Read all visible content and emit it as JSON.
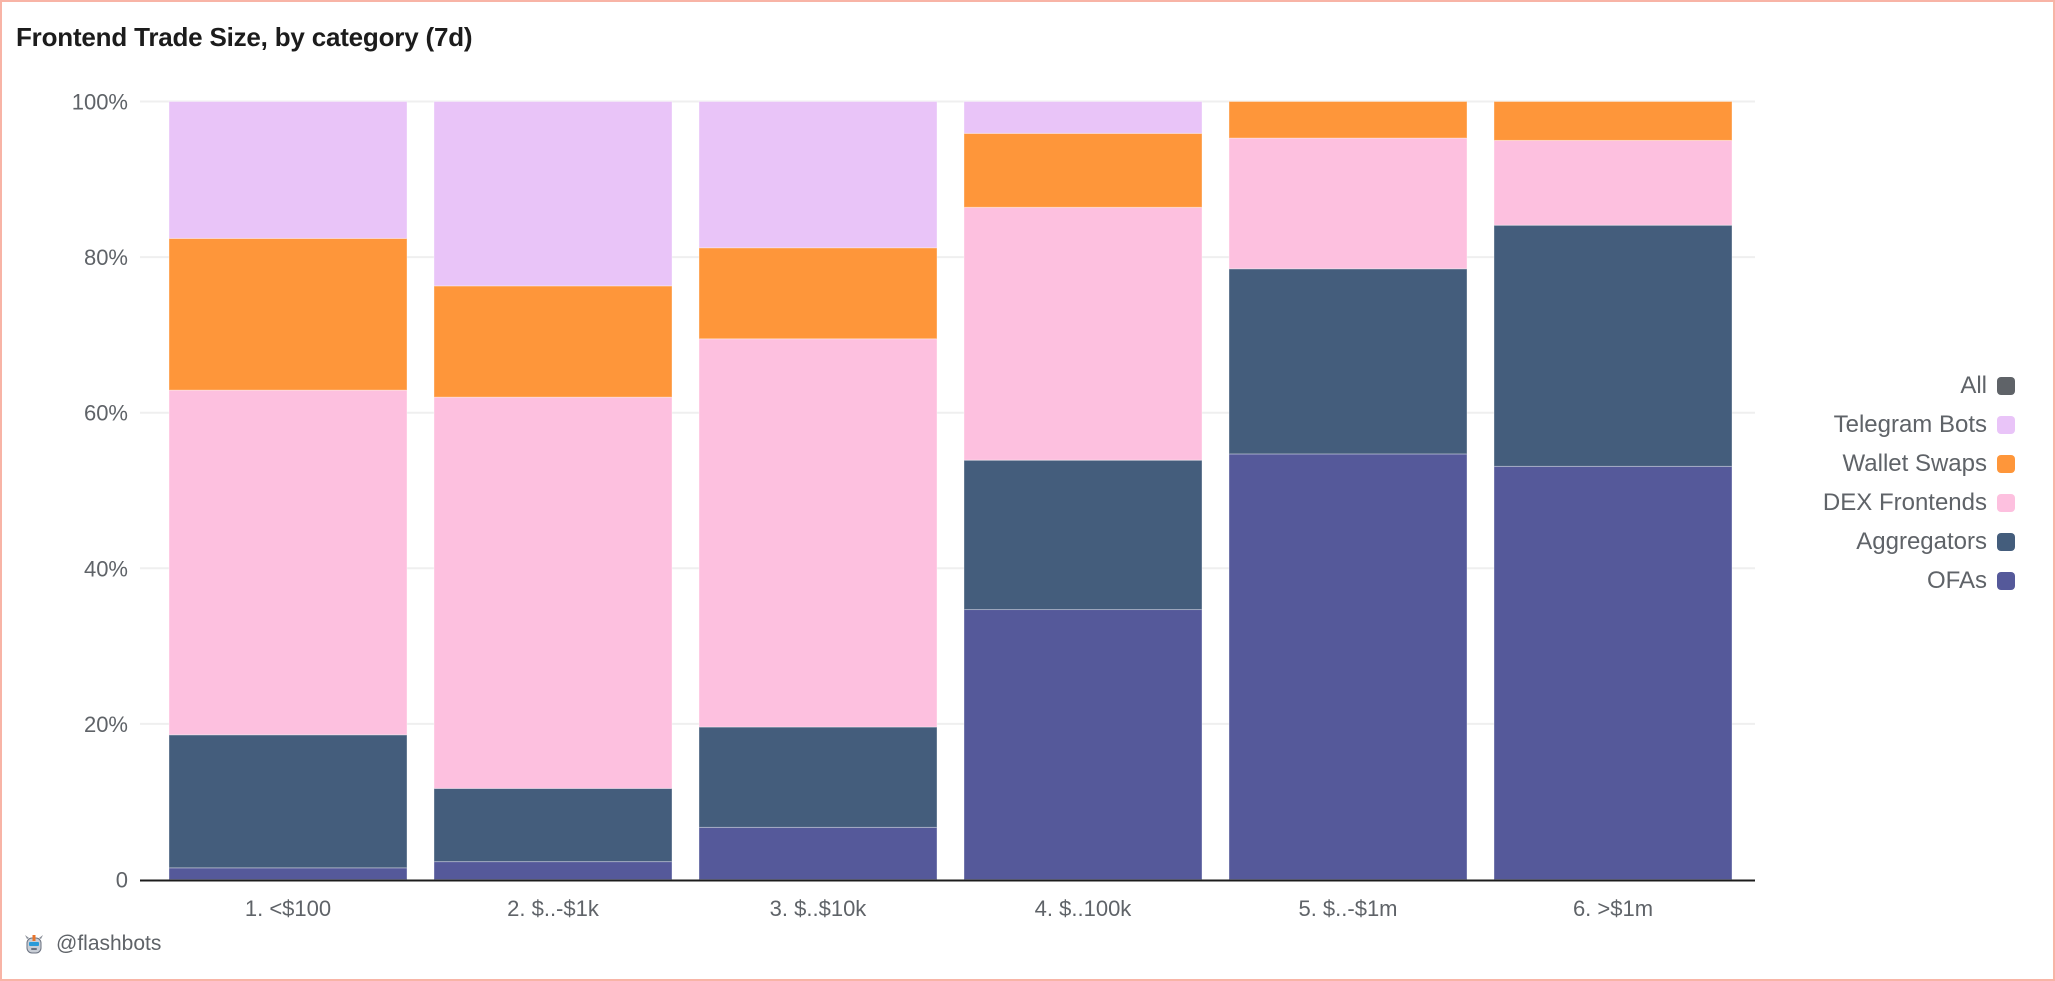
{
  "chart_data": {
    "type": "bar",
    "stacked": true,
    "normalized": true,
    "title": "Frontend Trade Size, by category (7d)",
    "xlabel": "",
    "ylabel": "",
    "ylim": [
      0,
      100
    ],
    "yticks": [
      0,
      20,
      40,
      60,
      80,
      100
    ],
    "ytick_labels": [
      "0",
      "20%",
      "40%",
      "60%",
      "80%",
      "100%"
    ],
    "grid": true,
    "legend_position": "right",
    "categories": [
      "1. <$100",
      "2. $..-$1k",
      "3. $..$10k",
      "4. $..100k",
      "5. $..-$1m",
      "6. >$1m"
    ],
    "series": [
      {
        "name": "OFAs",
        "color": "#55599a",
        "values": [
          1.5,
          2.3,
          6.7,
          34.7,
          54.7,
          53.1
        ]
      },
      {
        "name": "Aggregators",
        "color": "#445d7c",
        "values": [
          17.1,
          9.4,
          12.9,
          19.2,
          23.8,
          31.0
        ]
      },
      {
        "name": "DEX Frontends",
        "color": "#fdc0df",
        "values": [
          44.3,
          50.3,
          49.9,
          32.5,
          16.8,
          10.9
        ]
      },
      {
        "name": "Wallet Swaps",
        "color": "#fe963a",
        "values": [
          19.5,
          14.3,
          11.7,
          9.5,
          4.7,
          5.0
        ]
      },
      {
        "name": "Telegram Bots",
        "color": "#e9c4f8",
        "values": [
          17.6,
          23.7,
          18.8,
          4.1,
          0.0,
          0.0
        ]
      }
    ]
  },
  "legend": {
    "items": [
      {
        "label": "All",
        "color": "#5f6368"
      },
      {
        "label": "Telegram Bots",
        "color": "#e9c4f8"
      },
      {
        "label": "Wallet Swaps",
        "color": "#fe963a"
      },
      {
        "label": "DEX Frontends",
        "color": "#fdc0df"
      },
      {
        "label": "Aggregators",
        "color": "#445d7c"
      },
      {
        "label": "OFAs",
        "color": "#55599a"
      }
    ]
  },
  "footer": {
    "handle": "@flashbots",
    "icon": "robot-icon"
  }
}
